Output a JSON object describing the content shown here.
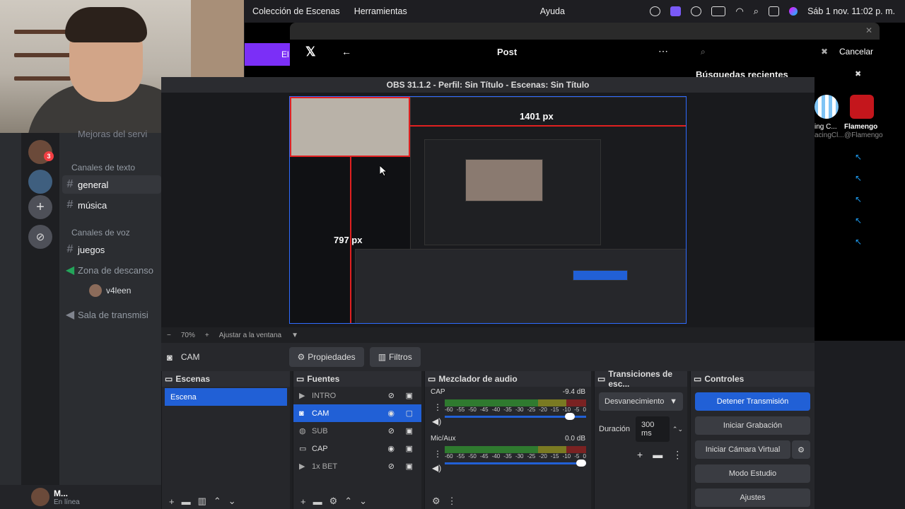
{
  "menubar": {
    "items": [
      "Colección de Escenas",
      "Herramientas",
      "Ayuda"
    ],
    "clock": "Sáb 1 nov.  11:02 p. m."
  },
  "discord": {
    "top_text": "Mejoras del servi",
    "badge": "3",
    "text_category": "Canales de texto",
    "voice_category": "Canales de voz",
    "channels": [
      {
        "name": "general"
      },
      {
        "name": "música"
      },
      {
        "name": "juegos"
      },
      {
        "name": "Zona de descanso"
      },
      {
        "name": "Sala de transmisi"
      }
    ],
    "voice_user": "v4leen",
    "user_name": "M...",
    "user_status": "En línea"
  },
  "xwin": {
    "post_title": "Post",
    "cancel": "Cancelar",
    "recent": "Búsquedas recientes",
    "profiles": [
      "ing C...",
      "Flamengo",
      "acingCl...",
      "@Flamengo"
    ],
    "left_frag": "El"
  },
  "obs": {
    "title": "OBS 31.1.2 - Perfil: Sin Título - Escenas: Sin Título",
    "preview": {
      "width_label": "1401 px",
      "height_label": "797 px"
    },
    "zoom": {
      "minus": "−",
      "value": "70%",
      "plus": "+",
      "fit": "Ajustar a la ventana"
    },
    "source_name": "CAM",
    "properties_btn": "Propiedades",
    "filters_btn": "Filtros",
    "scenes": {
      "title": "Escenas",
      "items": [
        "Escena"
      ]
    },
    "sources": {
      "title": "Fuentes",
      "items": [
        "INTRO",
        "CAM",
        "SUB",
        "CAP",
        "1x BET"
      ]
    },
    "mixer": {
      "title": "Mezclador de audio",
      "scale": [
        "-60",
        "-55",
        "-50",
        "-45",
        "-40",
        "-35",
        "-30",
        "-25",
        "-20",
        "-15",
        "-10",
        "-5",
        "0"
      ],
      "channels": [
        {
          "name": "CAP",
          "db": "-9.4 dB",
          "volume": 0.92
        },
        {
          "name": "Mic/Aux",
          "db": "0.0 dB",
          "volume": 1.0
        }
      ]
    },
    "transitions": {
      "title": "Transiciones de esc...",
      "selected": "Desvanecimiento",
      "duration_label": "Duración",
      "duration": "300 ms"
    },
    "controls": {
      "title": "Controles",
      "buttons": [
        "Detener Transmisión",
        "Iniciar Grabación",
        "Iniciar Cámara Virtual",
        "Modo Estudio",
        "Ajustes"
      ]
    }
  }
}
